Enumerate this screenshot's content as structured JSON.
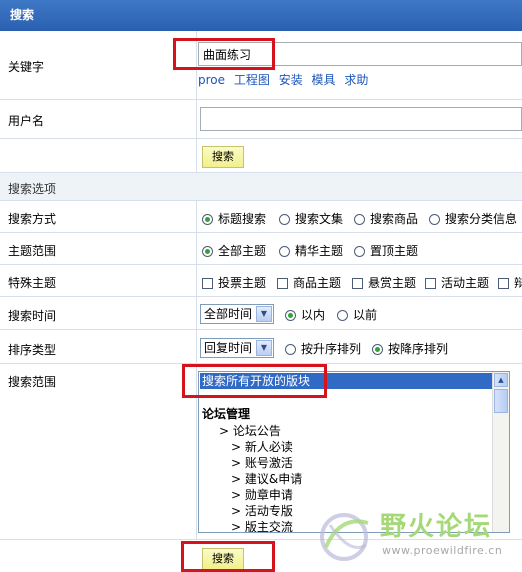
{
  "header": {
    "title": "搜索"
  },
  "keyword": {
    "label": "关键字",
    "value": "曲面练习",
    "suggestions": [
      "proe",
      "工程图",
      "安装",
      "模具",
      "求助"
    ]
  },
  "username": {
    "label": "用户名",
    "value": ""
  },
  "search_button_top": "搜索",
  "options_section": {
    "title": "搜索选项"
  },
  "search_mode": {
    "label": "搜索方式",
    "options": [
      {
        "label": "标题搜索",
        "checked": true
      },
      {
        "label": "搜索文集",
        "checked": false
      },
      {
        "label": "搜索商品",
        "checked": false
      },
      {
        "label": "搜索分类信息",
        "checked": false
      }
    ]
  },
  "topic_scope": {
    "label": "主题范围",
    "options": [
      {
        "label": "全部主题",
        "checked": true
      },
      {
        "label": "精华主题",
        "checked": false
      },
      {
        "label": "置顶主题",
        "checked": false
      }
    ]
  },
  "special_topic": {
    "label": "特殊主题",
    "options": [
      {
        "label": "投票主题"
      },
      {
        "label": "商品主题"
      },
      {
        "label": "悬赏主题"
      },
      {
        "label": "活动主题"
      },
      {
        "label": "辩"
      }
    ]
  },
  "search_time": {
    "label": "搜索时间",
    "select": "全部时间",
    "options": [
      {
        "label": "以内",
        "checked": true
      },
      {
        "label": "以前",
        "checked": false
      }
    ]
  },
  "sort_type": {
    "label": "排序类型",
    "select": "回复时间",
    "options": [
      {
        "label": "按升序排列",
        "checked": false
      },
      {
        "label": "按降序排列",
        "checked": true
      }
    ]
  },
  "search_scope": {
    "label": "搜索范围",
    "selected": "搜索所有开放的版块",
    "group": "论坛管理",
    "items": [
      "> 论坛公告",
      "> 新人必读",
      "> 账号激活",
      "> 建议&申请",
      "> 勋章申请",
      "> 活动专版",
      "> 版主交流"
    ]
  },
  "search_button_bottom": "搜索",
  "watermark": {
    "text": "野火论坛",
    "url": "www.proewildfire.cn"
  },
  "colors": {
    "header": "#2f67b8",
    "highlight": "#d5131d",
    "link": "#1d56b8",
    "button": "#f5f3a0"
  }
}
